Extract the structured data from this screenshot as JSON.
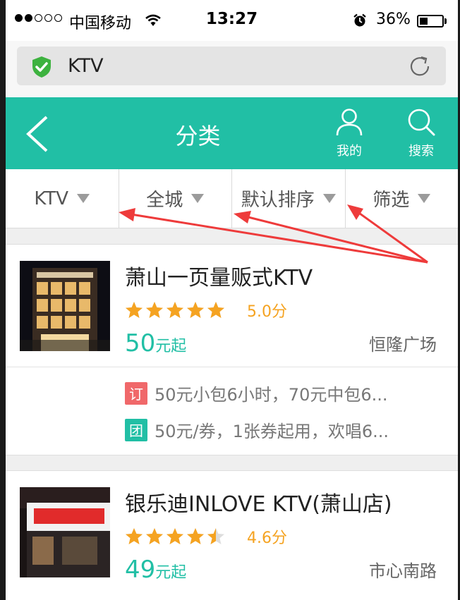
{
  "status_bar": {
    "carrier": "中国移动",
    "time": "13:27",
    "battery_percent": "36%",
    "battery_level": 0.36
  },
  "url_bar": {
    "text": "KTV"
  },
  "header": {
    "title": "分类",
    "mine_label": "我的",
    "search_label": "搜索"
  },
  "filters": [
    {
      "label": "KTV"
    },
    {
      "label": "全城"
    },
    {
      "label": "默认排序"
    },
    {
      "label": "筛选"
    }
  ],
  "listings": [
    {
      "name": "萧山一页量贩式KTV",
      "stars": 5.0,
      "rating_text": "5.0分",
      "price_num": "50",
      "price_unit": "元起",
      "area": "恒隆广场",
      "deals": [
        {
          "tag": "订",
          "text": "50元小包6小时，70元中包6..."
        },
        {
          "tag": "团",
          "text": "50元/券，1张券起用，欢唱6..."
        }
      ]
    },
    {
      "name": "银乐迪INLOVE KTV(萧山店)",
      "stars": 4.6,
      "rating_text": "4.6分",
      "price_num": "49",
      "price_unit": "元起",
      "area": "市心南路"
    }
  ],
  "colors": {
    "accent": "#21bfa5",
    "star": "#f5a321",
    "book_tag": "#f0686a",
    "annotation_arrow": "#ee3b3b"
  },
  "icons": [
    "back-arrow-icon",
    "user-icon",
    "search-icon",
    "shield-check-icon",
    "reload-icon",
    "wifi-icon",
    "alarm-icon",
    "dropdown-triangle-icon",
    "star-icon"
  ]
}
